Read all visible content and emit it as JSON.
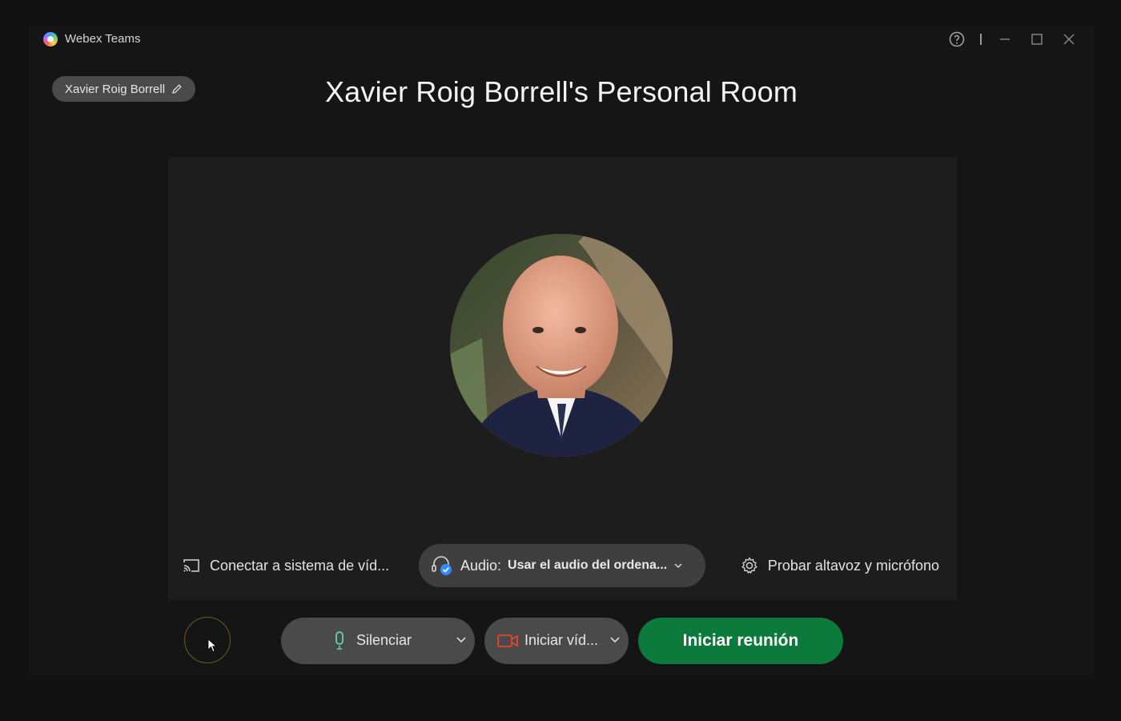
{
  "app": {
    "name": "Webex Teams"
  },
  "header": {
    "user_chip": "Xavier Roig Borrell",
    "room_title": "Xavier Roig Borrell's Personal Room"
  },
  "device_bar": {
    "connect_label": "Conectar a sistema de víd...",
    "audio_label": "Audio:",
    "audio_value": "Usar el audio del ordena...",
    "test_label": "Probar altavoz y micrófono"
  },
  "controls": {
    "mute_label": "Silenciar",
    "video_label": "Iniciar víd...",
    "start_label": "Iniciar reunión"
  },
  "colors": {
    "accent_green": "#0b7a3b",
    "mic_icon": "#5fd3a8",
    "camera_icon": "#e0452f",
    "audio_check": "#2d8cff"
  }
}
